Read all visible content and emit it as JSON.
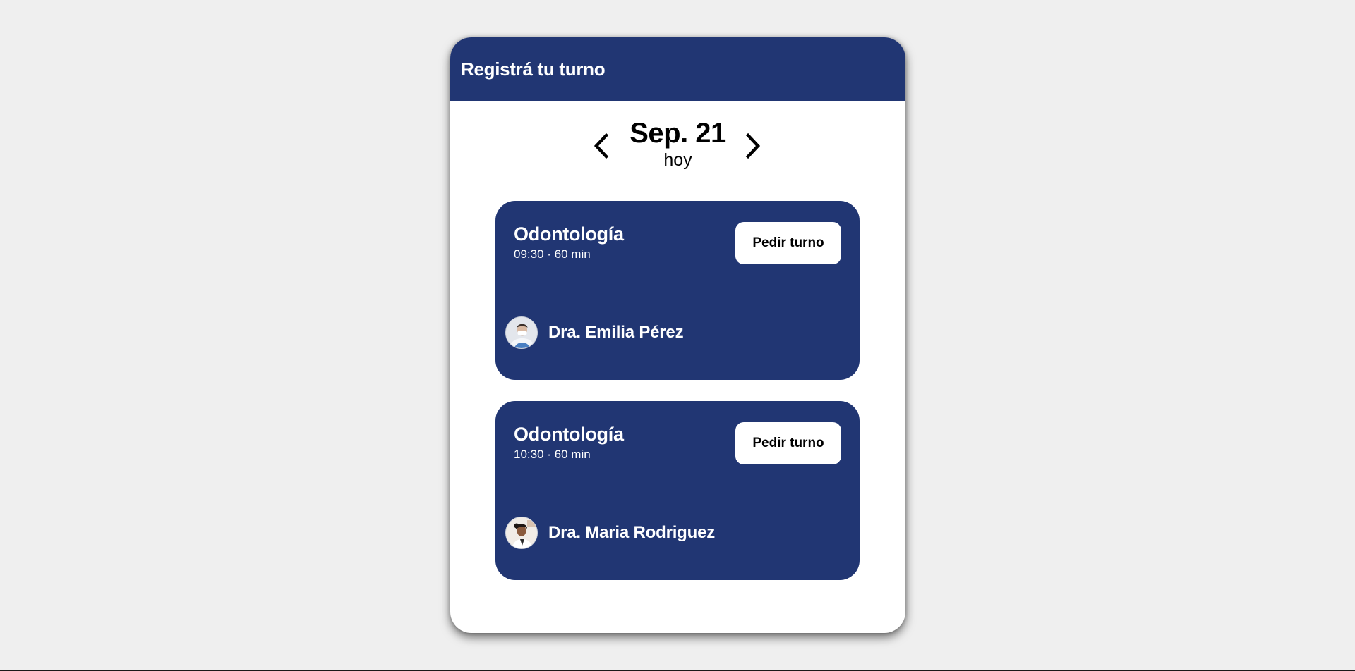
{
  "header": {
    "title": "Registrá tu turno"
  },
  "date_nav": {
    "date": "Sep. 21",
    "relative": "hoy",
    "prev_icon": "chevron-left-icon",
    "next_icon": "chevron-right-icon"
  },
  "appointments": [
    {
      "specialty": "Odontología",
      "time": "09:30 · 60 min",
      "button_label": "Pedir turno",
      "doctor": "Dra. Emilia Pérez",
      "avatar_icon": "doctor-avatar-icon"
    },
    {
      "specialty": "Odontología",
      "time": "10:30 · 60 min",
      "button_label": "Pedir turno",
      "doctor": "Dra. Maria Rodriguez",
      "avatar_icon": "doctor-avatar-icon"
    }
  ],
  "colors": {
    "brand": "#213673",
    "background": "#efefef",
    "card_text": "#ffffff"
  }
}
